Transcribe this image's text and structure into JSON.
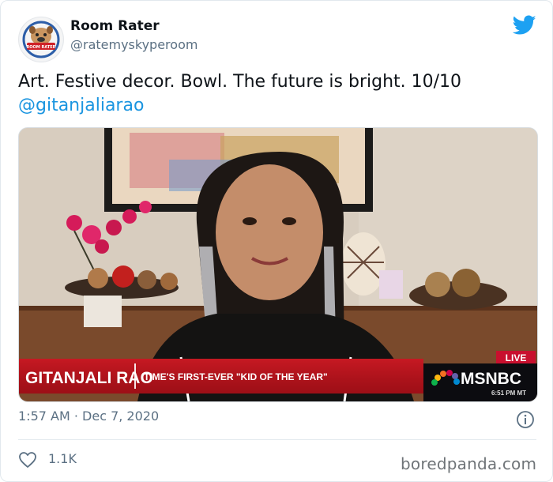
{
  "tweet": {
    "author": {
      "display_name": "Room Rater",
      "handle": "@ratemyskyperoom"
    },
    "text": "Art. Festive decor. Bowl. The future is bright. 10/10",
    "mention": "@gitanjaliarao",
    "timestamp": "1:57 AM · Dec 7, 2020",
    "likes": "1.1K"
  },
  "video": {
    "name_banner": "GITANJALI RAO",
    "subtitle_banner": "TIME'S FIRST-EVER \"KID OF THE YEAR\"",
    "live_badge": "LIVE",
    "network": "MSNBC",
    "clock": "6:51 PM MT"
  },
  "watermark": "boredpanda.com",
  "colors": {
    "link": "#1b95e0",
    "twitter_blue": "#1da1f2",
    "banner_red": "#b5121b",
    "muted": "#5b7083"
  }
}
